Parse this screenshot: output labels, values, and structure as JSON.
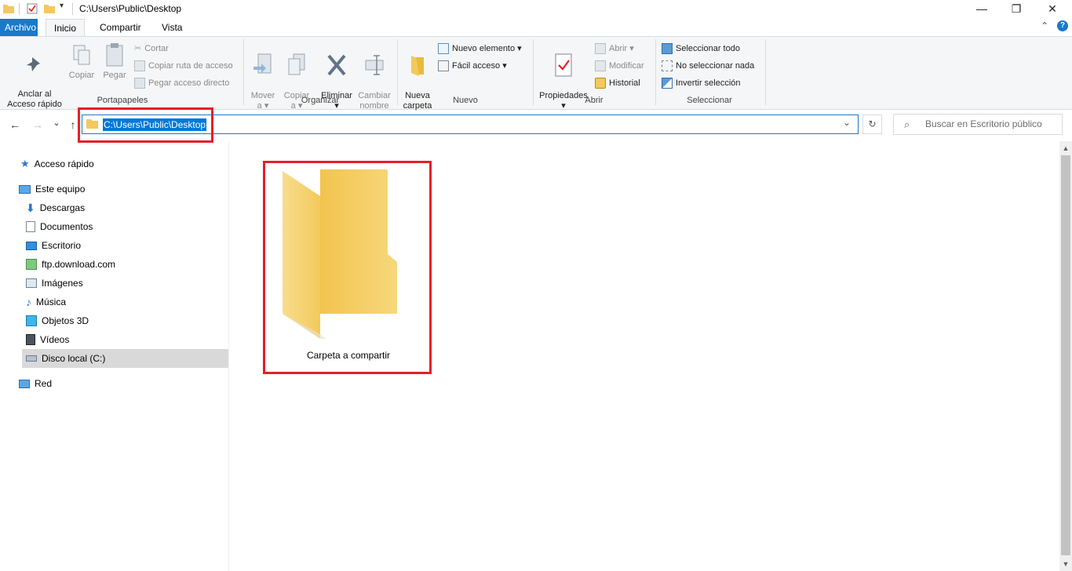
{
  "window": {
    "title": "C:\\Users\\Public\\Desktop",
    "minimize_glyph": "—",
    "restore_glyph": "❐",
    "close_glyph": "✕"
  },
  "tabs": [
    {
      "label": "Archivo"
    },
    {
      "label": "Inicio"
    },
    {
      "label": "Compartir"
    },
    {
      "label": "Vista"
    }
  ],
  "ribbon": {
    "collapse_glyph": "⌃",
    "help_glyph": "?",
    "groups": {
      "portapapeles": {
        "label": "Portapapeles",
        "anclar": "Anclar al\nAcceso rápido",
        "copiar": "Copiar",
        "pegar": "Pegar",
        "cortar": "Cortar",
        "copiar_ruta": "Copiar ruta de acceso",
        "pegar_acceso": "Pegar acceso directo"
      },
      "organizar": {
        "label": "Organizar",
        "mover": "Mover\na ▾",
        "copiar_a": "Copiar\na ▾",
        "eliminar": "Eliminar\n▾",
        "cambiar": "Cambiar\nnombre"
      },
      "nuevo": {
        "label": "Nuevo",
        "nueva_carpeta": "Nueva\ncarpeta",
        "nuevo_elemento": "Nuevo elemento ▾",
        "facil_acceso": "Fácil acceso ▾"
      },
      "abrir": {
        "label": "Abrir",
        "propiedades": "Propiedades\n▾",
        "abrir": "Abrir ▾",
        "modificar": "Modificar",
        "historial": "Historial"
      },
      "seleccionar": {
        "label": "Seleccionar",
        "todo": "Seleccionar todo",
        "nada": "No seleccionar nada",
        "invertir": "Invertir selección"
      }
    }
  },
  "navbar": {
    "back_glyph": "←",
    "forward_glyph": "→",
    "recent_glyph": "⌄",
    "up_glyph": "↑",
    "address": "C:\\Users\\Public\\Desktop",
    "dropdown_glyph": "⌄",
    "refresh_glyph": "↻",
    "search_placeholder": "Buscar en Escritorio público"
  },
  "nav_pane": [
    {
      "label": "Acceso rápido"
    },
    {
      "label": "Este equipo"
    },
    {
      "label": "Descargas"
    },
    {
      "label": "Documentos"
    },
    {
      "label": "Escritorio"
    },
    {
      "label": "ftp.download.com"
    },
    {
      "label": "Imágenes"
    },
    {
      "label": "Música"
    },
    {
      "label": "Objetos 3D"
    },
    {
      "label": "Vídeos"
    },
    {
      "label": "Disco local (C:)"
    },
    {
      "label": "Red"
    }
  ],
  "content": {
    "items": [
      {
        "label": "Carpeta a compartir"
      }
    ]
  },
  "colors": {
    "accent": "#1979ca",
    "selection": "#0078d7",
    "highlight_box": "#e3202a",
    "folder": "#f3c95d"
  }
}
